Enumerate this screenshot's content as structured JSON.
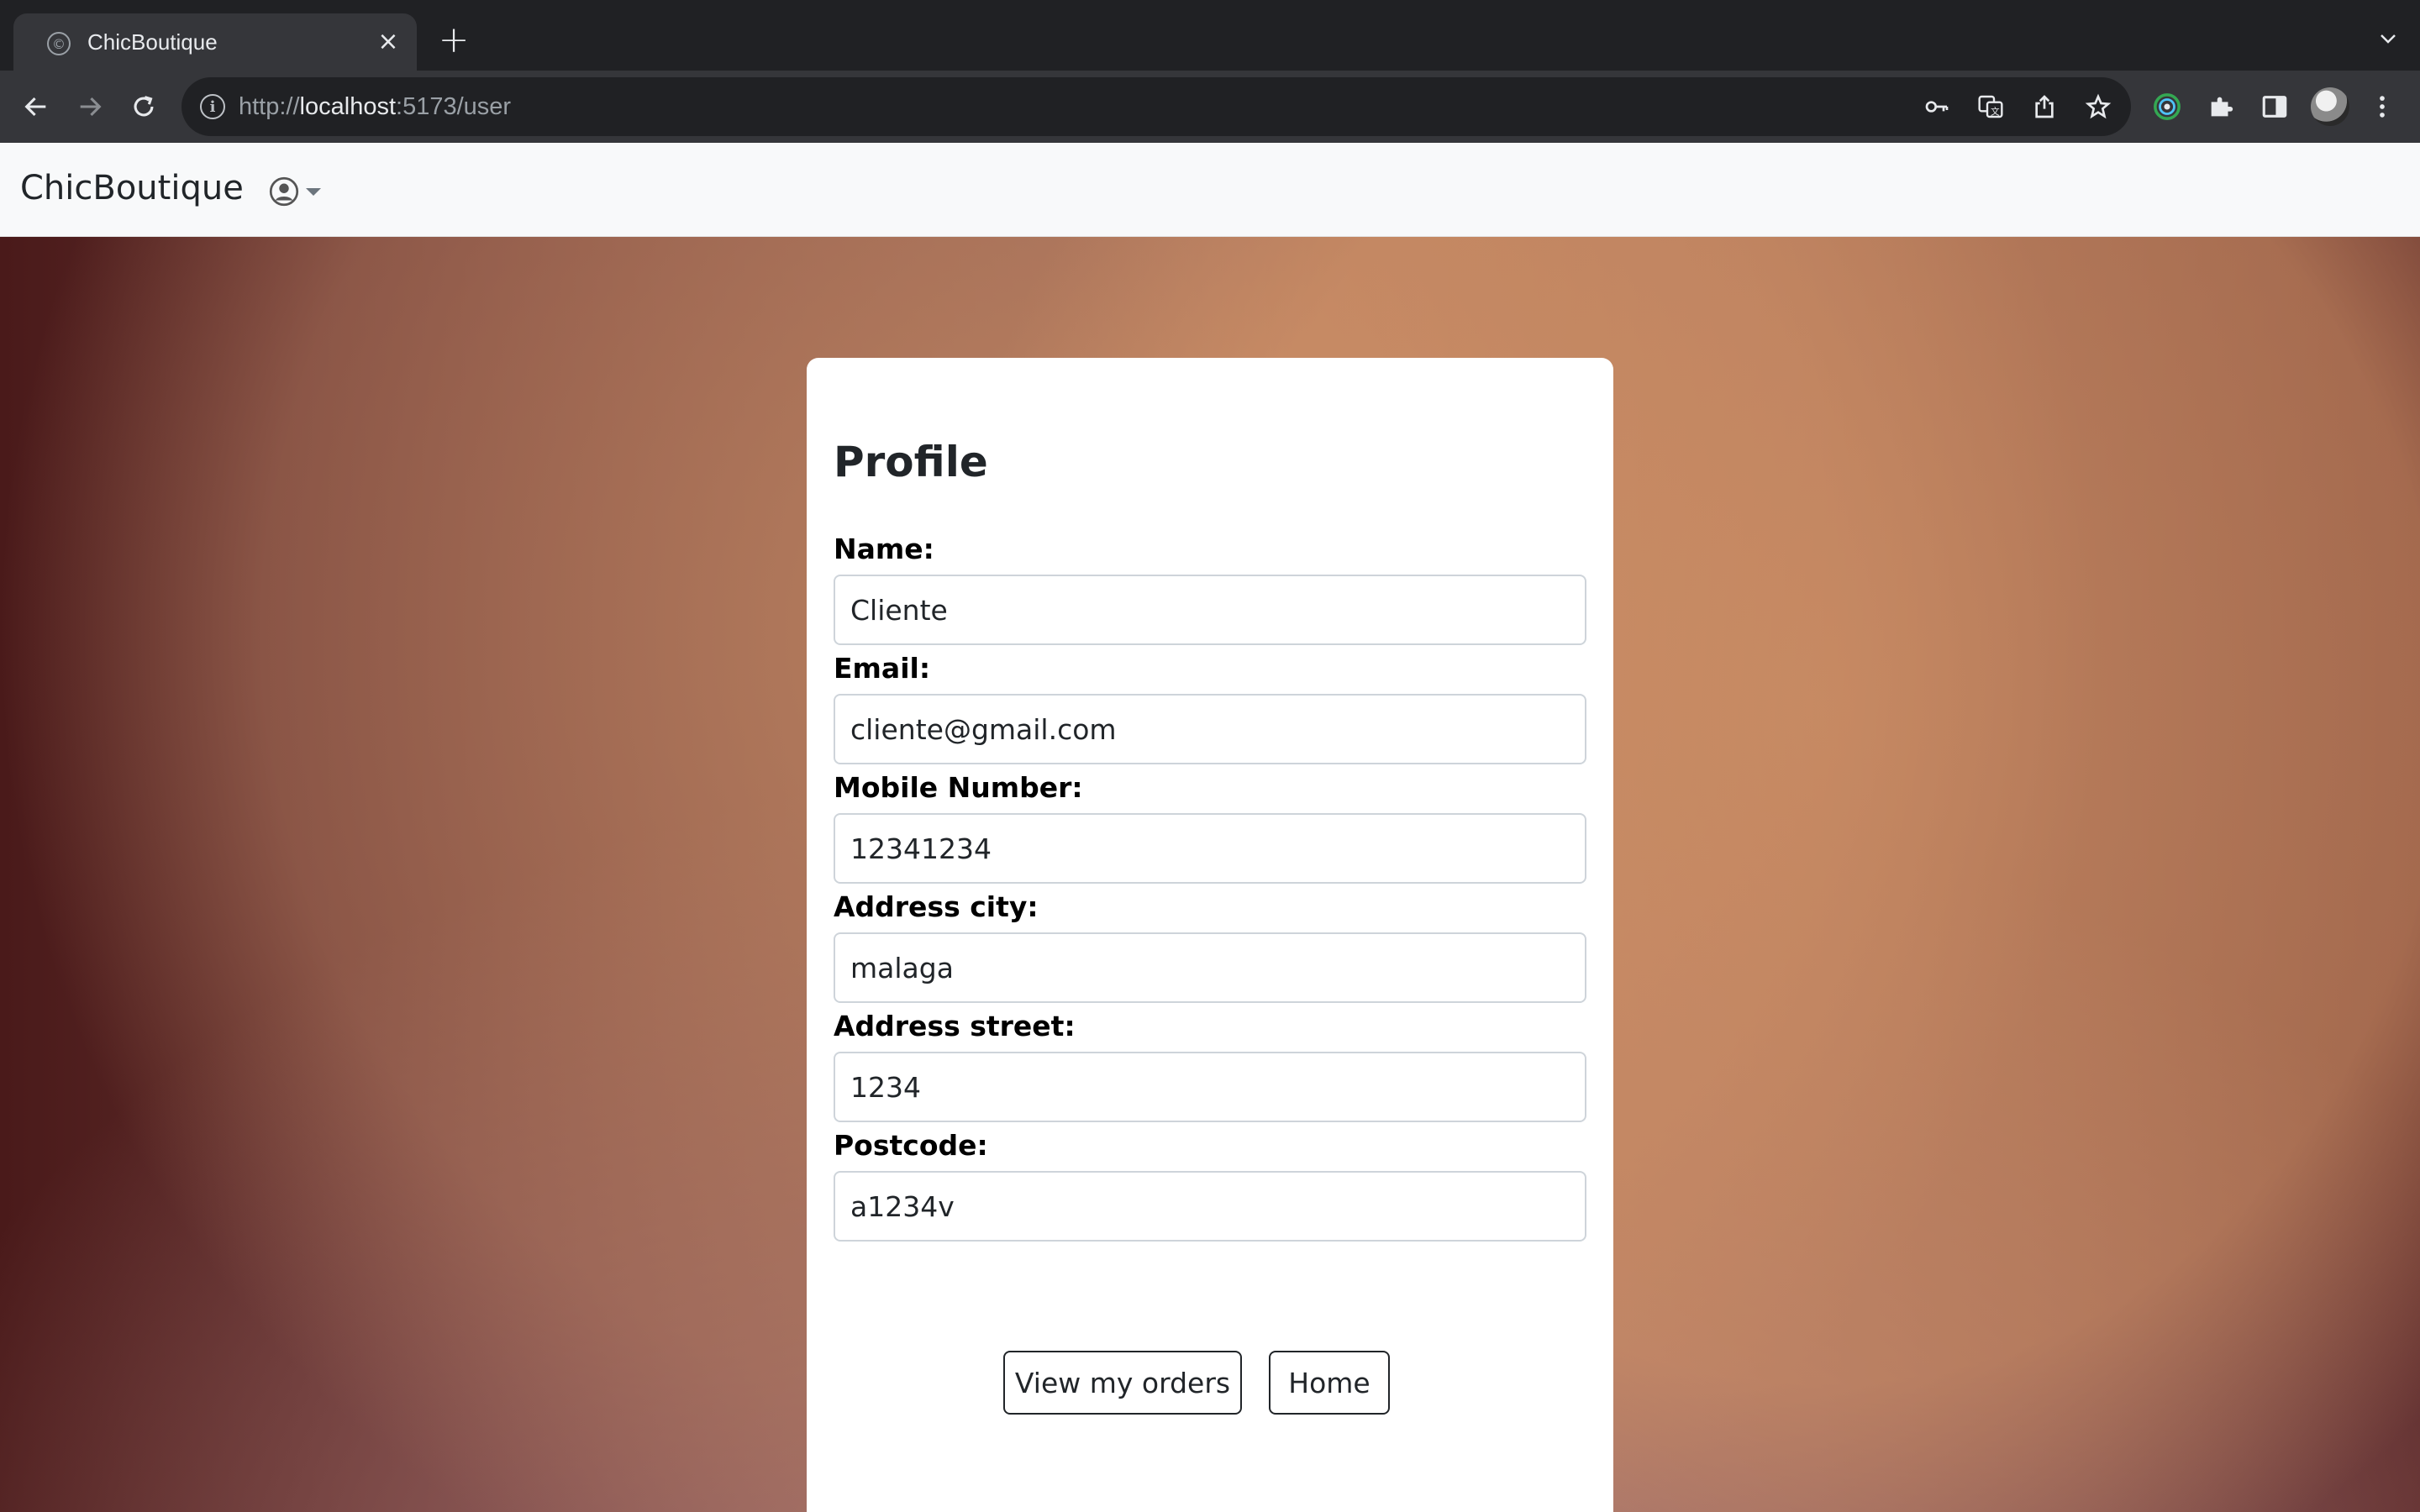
{
  "browser": {
    "tab_title": "ChicBoutique",
    "url_scheme": "http://",
    "url_host": "localhost",
    "url_rest": ":5173/user",
    "icons": [
      "back-arrow-icon",
      "forward-arrow-icon",
      "reload-icon",
      "info-icon",
      "key-icon",
      "translate-icon",
      "share-icon",
      "star-icon",
      "extension-icon",
      "puzzle-icon",
      "sidepanel-icon",
      "kebab-menu-icon"
    ]
  },
  "navbar": {
    "brand": "ChicBoutique",
    "user_menu_icon": "user-circle-icon"
  },
  "profile": {
    "title": "Profile",
    "fields": {
      "name": {
        "label": "Name:",
        "value": "Cliente"
      },
      "email": {
        "label": "Email:",
        "value": "cliente@gmail.com"
      },
      "mobile": {
        "label": "Mobile Number:",
        "value": "12341234"
      },
      "city": {
        "label": "Address city:",
        "value": "malaga"
      },
      "street": {
        "label": "Address street:",
        "value": "1234"
      },
      "postcode": {
        "label": "Postcode:",
        "value": "a1234v"
      }
    },
    "buttons": {
      "orders": "View my orders",
      "home": "Home"
    }
  },
  "colors": {
    "card_bg": "#ffffff",
    "navbar_bg": "#f8f9fa",
    "chrome_dark": "#202124",
    "chrome_toolbar": "#35363a"
  }
}
